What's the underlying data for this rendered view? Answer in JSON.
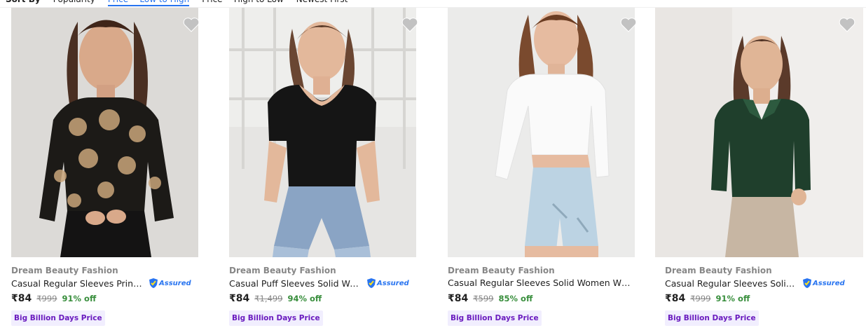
{
  "sort": {
    "label": "Sort By",
    "options": [
      "Popularity",
      "Price -- Low to High",
      "Price -- High to Low",
      "Newest First"
    ]
  },
  "colors": {
    "offer_green": "#388e3c",
    "badge_purple": "#6a1bbf",
    "badge_bg": "#f1eefe",
    "assured_blue": "#2874f0"
  },
  "products": [
    {
      "brand": "Dream Beauty Fashion",
      "title": "Casual Regular Sleeves Printed Women Black Top",
      "assured": "Assured",
      "price": "₹84",
      "mrp": "₹999",
      "discount": "91% off",
      "badge": "Big Billion Days Price",
      "image": "model-floral-black-top"
    },
    {
      "brand": "Dream Beauty Fashion",
      "title": "Casual Puff Sleeves Solid Women Black Top",
      "assured": "Assured",
      "price": "₹84",
      "mrp": "₹1,499",
      "discount": "94% off",
      "badge": "Big Billion Days Price",
      "image": "model-black-puff-top"
    },
    {
      "brand": "Dream Beauty Fashion",
      "title": "Casual Regular Sleeves Solid Women White Top",
      "assured": "",
      "price": "₹84",
      "mrp": "₹599",
      "discount": "85% off",
      "badge": "Big Billion Days Price",
      "image": "model-white-crop-top"
    },
    {
      "brand": "Dream Beauty Fashion",
      "title": "Casual Regular Sleeves Solid Women Green Top",
      "assured": "Assured",
      "price": "₹84",
      "mrp": "₹999",
      "discount": "91% off",
      "badge": "Big Billion Days Price",
      "image": "model-green-collar-top"
    }
  ]
}
